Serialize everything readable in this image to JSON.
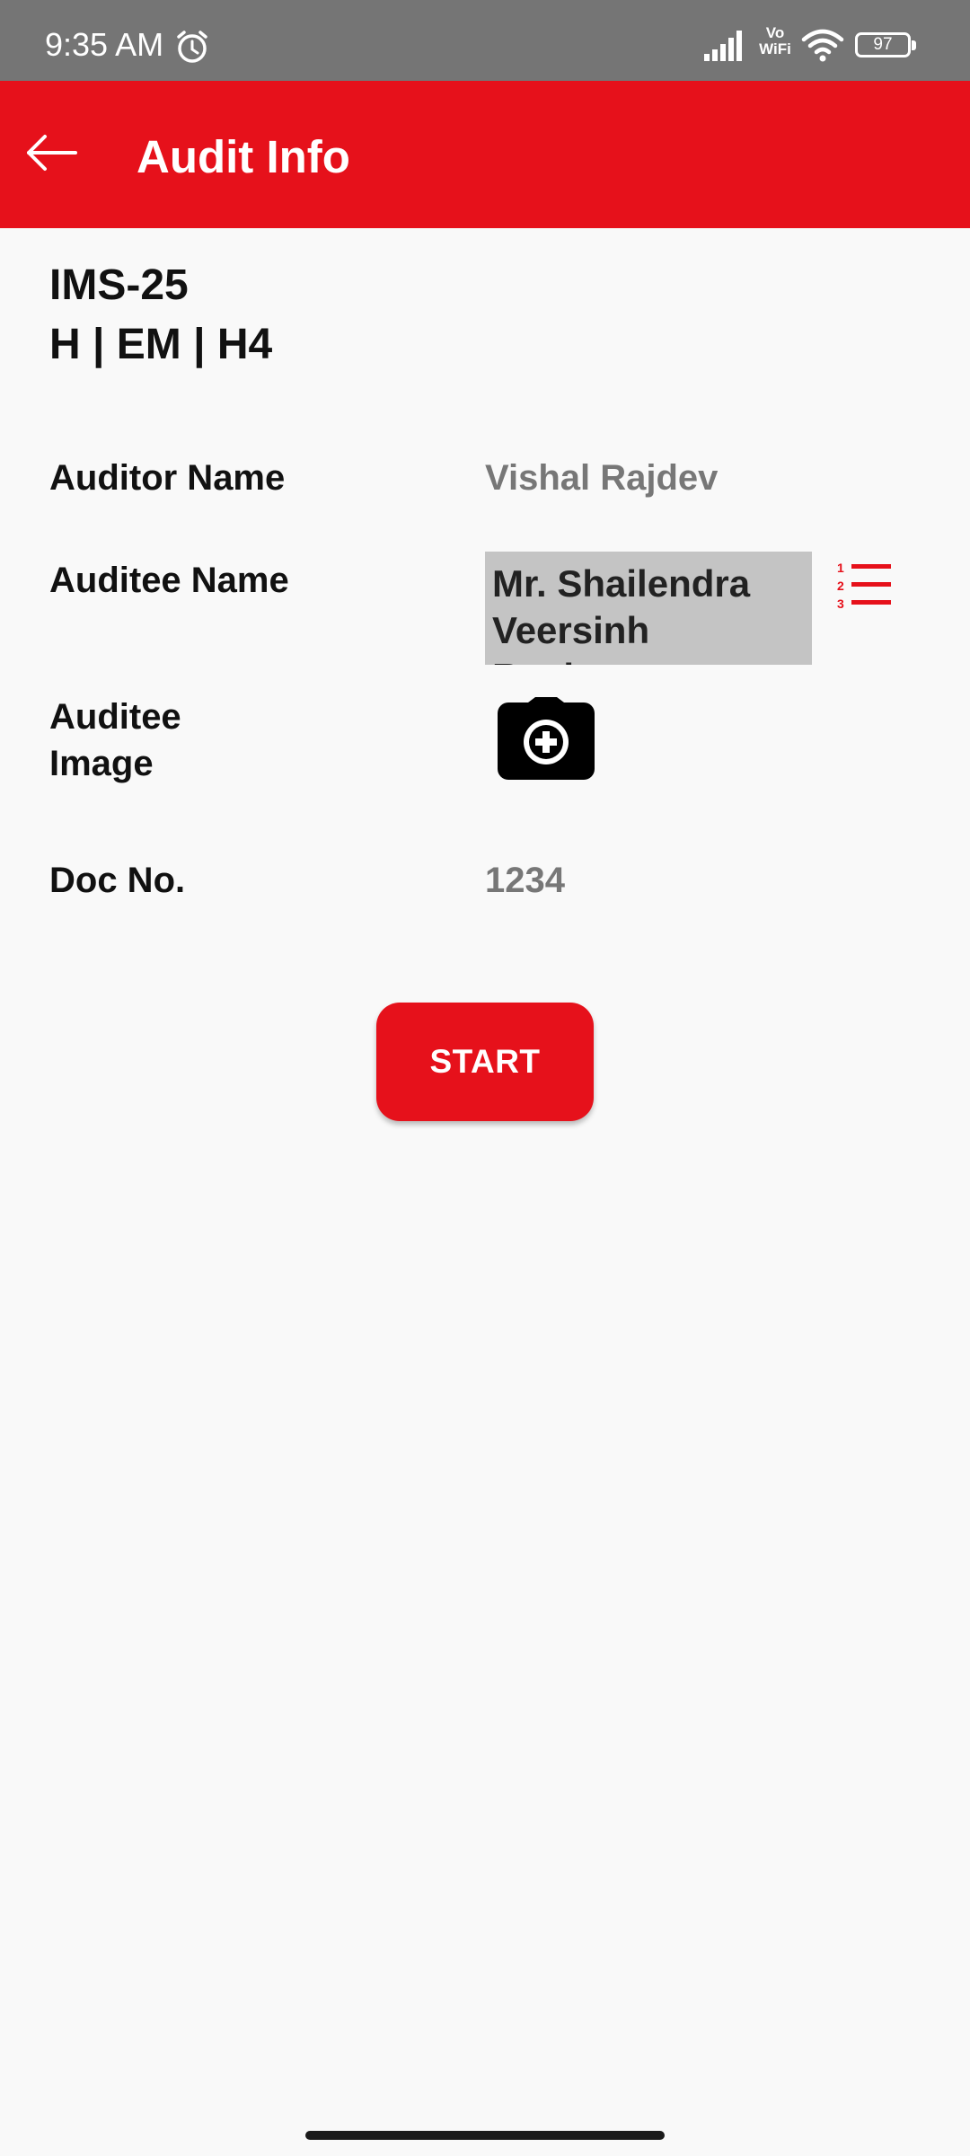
{
  "status_bar": {
    "time": "9:35 AM",
    "vowifi_label": "Vo\nWiFi",
    "battery_level": "97",
    "icons": [
      "alarm-icon",
      "signal-icon",
      "vowifi-icon",
      "wifi-icon",
      "battery-icon"
    ]
  },
  "app_bar": {
    "title": "Audit Info",
    "back_icon": "arrow-left-icon",
    "background_color": "#e6111b"
  },
  "header": {
    "line1": "IMS-25",
    "line2": "H | EM | H4"
  },
  "fields": {
    "auditor_name": {
      "label": "Auditor Name",
      "value": "Vishal Rajdev"
    },
    "auditee_name": {
      "label": "Auditee Name",
      "value": "Mr. Shailendra\nVeersinh Raghav,",
      "list_icon": "numbered-list-icon"
    },
    "auditee_image": {
      "label": "Auditee Image",
      "icon": "add-camera-icon"
    },
    "doc_no": {
      "label": "Doc No.",
      "value": "1234"
    }
  },
  "actions": {
    "start_label": "START"
  },
  "colors": {
    "accent": "#e6111b",
    "status_bar": "#757575",
    "value_text": "#777777",
    "auditee_box": "#c4c4c4",
    "background": "#f9f9f9"
  }
}
